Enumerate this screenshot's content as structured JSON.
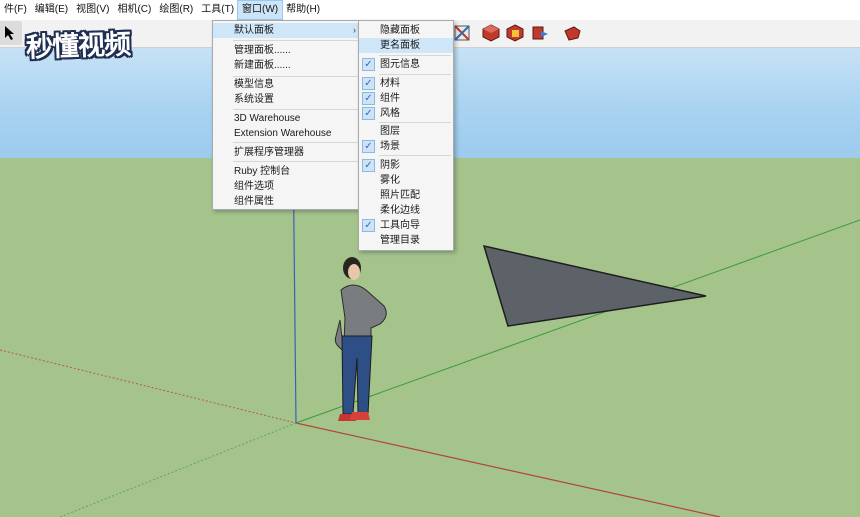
{
  "menubar": {
    "items": [
      "件(F)",
      "编辑(E)",
      "视图(V)",
      "相机(C)",
      "绘图(R)",
      "工具(T)",
      "窗口(W)",
      "帮助(H)"
    ],
    "active_index": 6
  },
  "watermark": {
    "text": "秒懂视频"
  },
  "window_menu": {
    "items": [
      {
        "label": "默认面板",
        "has_submenu": true,
        "highlighted": true
      },
      {
        "label": "管理面板......"
      },
      {
        "label": "新建面板......"
      },
      {
        "label": "模型信息"
      },
      {
        "label": "系统设置"
      },
      {
        "label": "3D Warehouse"
      },
      {
        "label": "Extension Warehouse"
      },
      {
        "label": "扩展程序管理器"
      },
      {
        "label": "Ruby 控制台"
      },
      {
        "label": "组件选项"
      },
      {
        "label": "组件属性"
      }
    ]
  },
  "panels_submenu": {
    "items": [
      {
        "label": "隐藏面板",
        "checked": false
      },
      {
        "label": "更名面板",
        "checked": false,
        "highlighted": true
      },
      {
        "label": "图元信息",
        "checked": true
      },
      {
        "label": "材料",
        "checked": true
      },
      {
        "label": "组件",
        "checked": true
      },
      {
        "label": "风格",
        "checked": true
      },
      {
        "label": "图层",
        "checked": false
      },
      {
        "label": "场景",
        "checked": true
      },
      {
        "label": "阴影",
        "checked": true
      },
      {
        "label": "雾化",
        "checked": false
      },
      {
        "label": "照片匹配",
        "checked": false
      },
      {
        "label": "柔化边线",
        "checked": false
      },
      {
        "label": "工具向导",
        "checked": true
      },
      {
        "label": "管理目录",
        "checked": false
      }
    ]
  },
  "colors": {
    "sky": "#a9d3f1",
    "ground": "#a4c48c",
    "menu_highlight": "#cfe5f8",
    "triangle": "#5d6268"
  }
}
